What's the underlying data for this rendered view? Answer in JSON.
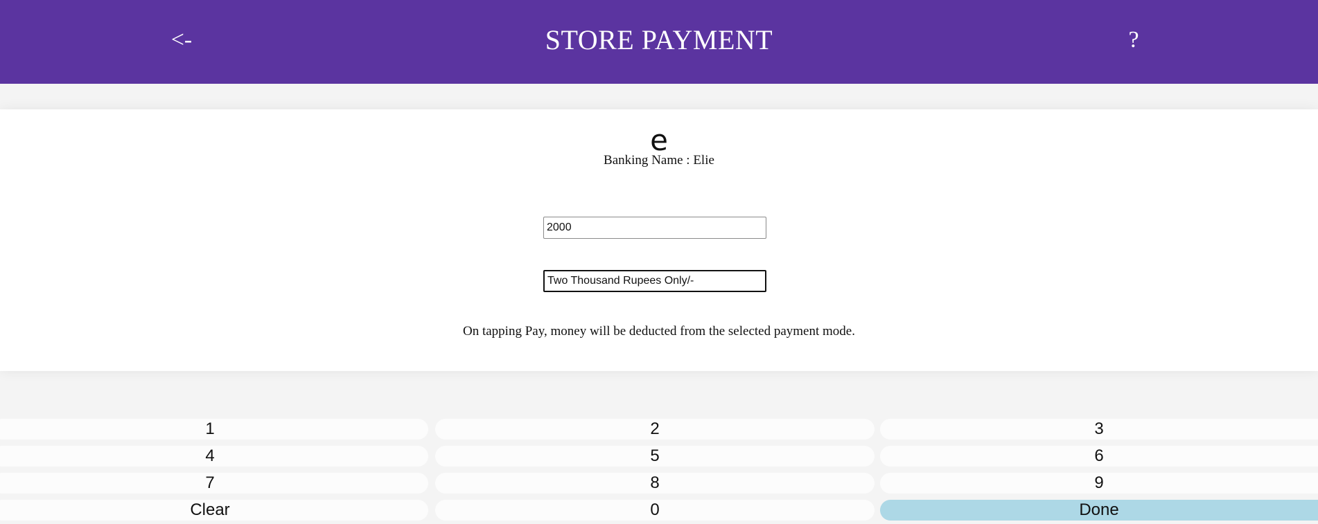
{
  "header": {
    "back_label": "<-",
    "title": "STORE PAYMENT",
    "help_label": "?",
    "background_color": "#5b34a0"
  },
  "payee": {
    "avatar_letter": "e",
    "banking_name": "Banking Name : Elie"
  },
  "form": {
    "amount_value": "2000",
    "amount_words_value": "Two Thousand Rupees Only/-"
  },
  "notice": "On tapping Pay, money will be deducted from the selected payment mode.",
  "keypad": {
    "k1": "1",
    "k2": "2",
    "k3": "3",
    "k4": "4",
    "k5": "5",
    "k6": "6",
    "k7": "7",
    "k8": "8",
    "k9": "9",
    "clear": "Clear",
    "k0": "0",
    "done": "Done",
    "done_color": "#add8e6"
  }
}
